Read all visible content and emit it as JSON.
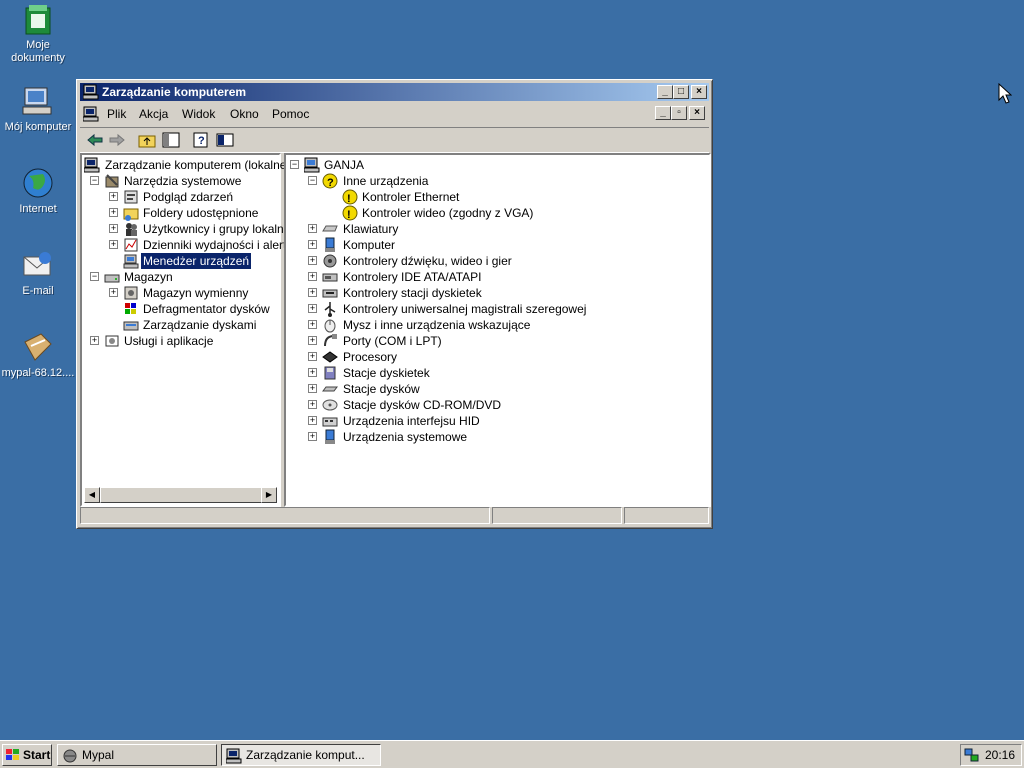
{
  "desktop": {
    "icons": [
      {
        "label": "Moje dokumenty"
      },
      {
        "label": "Mój komputer"
      },
      {
        "label": "Internet"
      },
      {
        "label": "E-mail"
      },
      {
        "label": "mypal-68.12...."
      }
    ]
  },
  "window": {
    "title": "Zarządzanie komputerem",
    "menu": [
      "Plik",
      "Akcja",
      "Widok",
      "Okno",
      "Pomoc"
    ],
    "left_tree": [
      {
        "label": "Zarządzanie komputerem (lokalne)"
      },
      {
        "label": "Narzędzia systemowe"
      },
      {
        "label": "Podgląd zdarzeń"
      },
      {
        "label": "Foldery udostępnione"
      },
      {
        "label": "Użytkownicy i grupy lokalne"
      },
      {
        "label": "Dzienniki wydajności i alerty"
      },
      {
        "label": "Menedżer urządzeń"
      },
      {
        "label": "Magazyn"
      },
      {
        "label": "Magazyn wymienny"
      },
      {
        "label": "Defragmentator dysków"
      },
      {
        "label": "Zarządzanie dyskami"
      },
      {
        "label": "Usługi i aplikacje"
      }
    ],
    "right_tree": [
      {
        "label": "GANJA"
      },
      {
        "label": "Inne urządzenia"
      },
      {
        "label": "Kontroler Ethernet"
      },
      {
        "label": "Kontroler wideo (zgodny z VGA)"
      },
      {
        "label": "Klawiatury"
      },
      {
        "label": "Komputer"
      },
      {
        "label": "Kontrolery dźwięku, wideo i gier"
      },
      {
        "label": "Kontrolery IDE ATA/ATAPI"
      },
      {
        "label": "Kontrolery stacji dyskietek"
      },
      {
        "label": "Kontrolery uniwersalnej magistrali szeregowej"
      },
      {
        "label": "Mysz i inne urządzenia wskazujące"
      },
      {
        "label": "Porty (COM i LPT)"
      },
      {
        "label": "Procesory"
      },
      {
        "label": "Stacje dyskietek"
      },
      {
        "label": "Stacje dysków"
      },
      {
        "label": "Stacje dysków CD-ROM/DVD"
      },
      {
        "label": "Urządzenia interfejsu HID"
      },
      {
        "label": "Urządzenia systemowe"
      }
    ]
  },
  "taskbar": {
    "start": "Start",
    "tasks": [
      "Mypal",
      "Zarządzanie komput..."
    ],
    "clock": "20:16"
  },
  "colors": {
    "desktop": "#3a6ea5",
    "title_start": "#0a246a",
    "title_end": "#a6caf0",
    "chrome": "#d4d0c8"
  }
}
